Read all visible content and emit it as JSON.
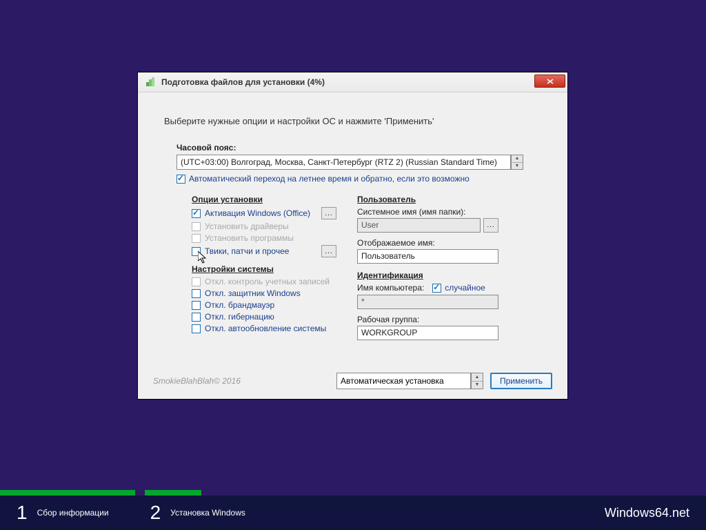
{
  "title": "Подготовка файлов для установки (4%)",
  "instruction": "Выберите нужные опции и настройки ОС и нажмите 'Применить'",
  "timezone": {
    "label": "Часовой пояс:",
    "value": "(UTC+03:00) Волгоград, Москва, Санкт-Петербург (RTZ 2) (Russian Standard Time)",
    "dst": "Автоматический переход на летнее время и обратно, если это возможно"
  },
  "install_opts": {
    "title": "Опции установки",
    "activate": "Активация Windows (Office)",
    "drivers": "Установить драйверы",
    "programs": "Установить программы",
    "tweaks": "Твики, патчи и прочее"
  },
  "sys_opts": {
    "title": "Настройки системы",
    "uac": "Откл. контроль учетных записей",
    "defender": "Откл. защитник Windows",
    "firewall": "Откл. брандмауэр",
    "hibernate": "Откл. гибернацию",
    "updates": "Откл. автообновление системы"
  },
  "user": {
    "title": "Пользователь",
    "sysname_label": "Системное имя (имя папки):",
    "sysname_value": "User",
    "dispname_label": "Отображаемое имя:",
    "dispname_value": "Пользователь"
  },
  "ident": {
    "title": "Идентификация",
    "compname_label": "Имя компьютера:",
    "random": "случайное",
    "compname_value": "*",
    "workgroup_label": "Рабочая группа:",
    "workgroup_value": "WORKGROUP"
  },
  "footer": {
    "copyright": "SmokieBlahBlah© 2016",
    "install_mode": "Автоматическая установка",
    "apply": "Применить"
  },
  "steps": {
    "s1": "Сбор информации",
    "s2": "Установка Windows"
  },
  "brand": "Windows64.net"
}
